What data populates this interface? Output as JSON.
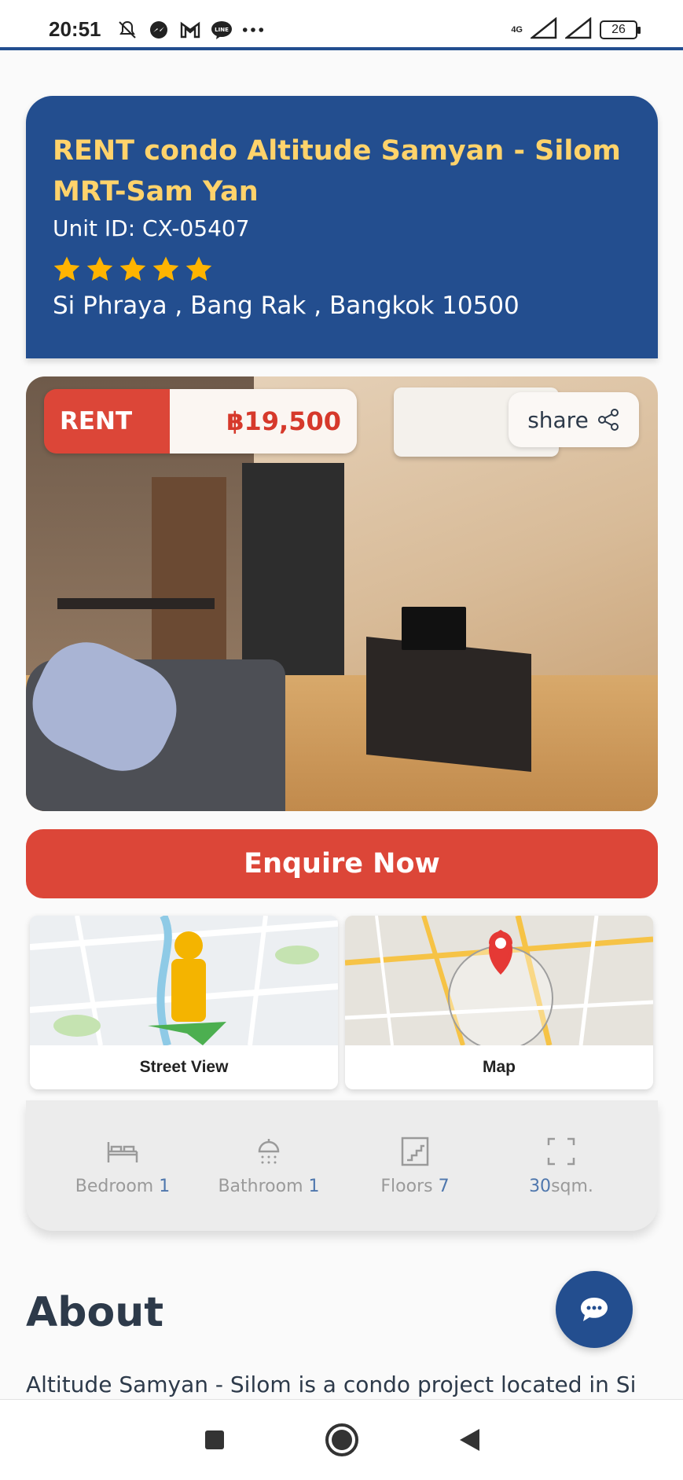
{
  "status_bar": {
    "time": "20:51",
    "network": "4G",
    "battery": "26",
    "icons": [
      "mute-icon",
      "messenger-icon",
      "gmail-icon",
      "line-icon",
      "more-icon",
      "signal-icon",
      "battery-icon"
    ]
  },
  "listing": {
    "title": "RENT condo Altitude Samyan - Silom MRT-Sam Yan",
    "unit_id": "Unit ID: CX-05407",
    "rating": 5,
    "address": "Si Phraya , Bang Rak , Bangkok 10500"
  },
  "photo": {
    "type_badge": "RENT",
    "price": "฿19,500",
    "share_label": "share"
  },
  "actions": {
    "enquire_label": "Enquire Now"
  },
  "tiles": [
    {
      "label": "Street View"
    },
    {
      "label": "Map"
    }
  ],
  "features": [
    {
      "label": "Bedroom",
      "value": "1"
    },
    {
      "label": "Bathroom",
      "value": "1"
    },
    {
      "label": "Floors",
      "value": "7"
    },
    {
      "value": "30",
      "unit": "sqm."
    }
  ],
  "about": {
    "title": "About",
    "text": "Altitude Samyan - Silom is a condo project located in Si"
  },
  "colors": {
    "primary": "#234e8f",
    "accent": "#dc4638",
    "title_yellow": "#ffd36b",
    "star": "#ffb400",
    "feature_value": "#4f77ad"
  }
}
